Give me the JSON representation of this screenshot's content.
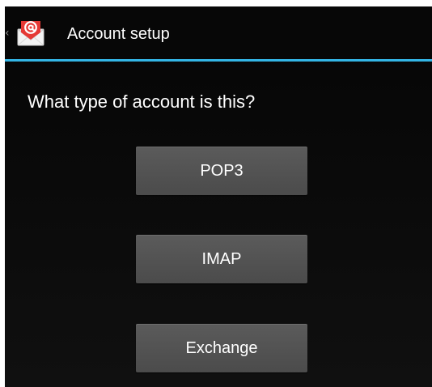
{
  "action_bar": {
    "title": "Account setup",
    "up_icon": "chevron-left-icon",
    "app_icon": "email-icon",
    "divider_color": "#33b5e5"
  },
  "main": {
    "question": "What type of account is this?",
    "options": [
      {
        "label": "POP3"
      },
      {
        "label": "IMAP"
      },
      {
        "label": "Exchange"
      }
    ]
  },
  "colors": {
    "background": "#0b0b0b",
    "button": "#545454",
    "text": "#ffffff",
    "accent": "#33b5e5",
    "icon_red": "#e53935"
  }
}
